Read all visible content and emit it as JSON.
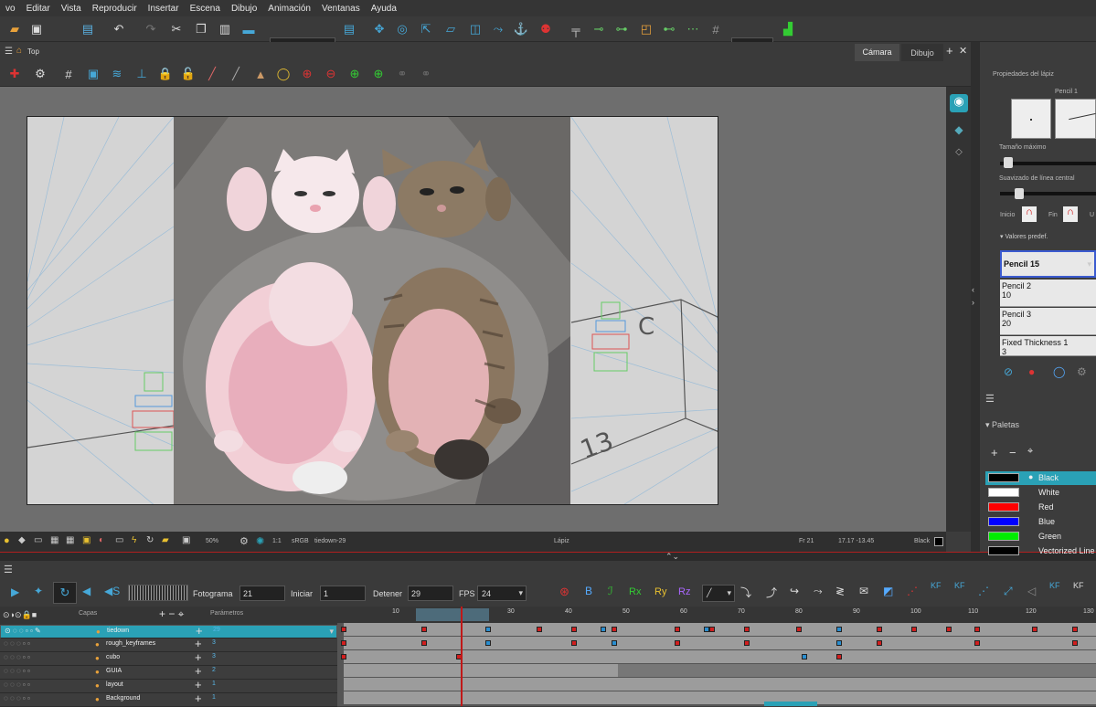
{
  "menu": [
    "vo",
    "Editar",
    "Vista",
    "Reproducir",
    "Insertar",
    "Escena",
    "Dibujo",
    "Animación",
    "Ventanas",
    "Ayuda"
  ],
  "toolbar": {
    "preset": "Default"
  },
  "view": {
    "title": "Top",
    "tabs": [
      "Cámara",
      "Dibujo"
    ],
    "active_tab": "Cámara"
  },
  "status": {
    "zoom": "50%",
    "ratio": "1:1",
    "colorspace": "sRGB",
    "scene": "tiedown-29",
    "tool": "Lápiz",
    "frame": "Fr 21",
    "coords": "17.17 -13.45",
    "color": "Black"
  },
  "timeline": {
    "frame_label": "Fotograma",
    "frame": "21",
    "start_label": "Iniciar",
    "start": "1",
    "stop_label": "Detener",
    "stop": "29",
    "fps_label": "FPS",
    "fps": "24",
    "layers_header": "Capas",
    "params_header": "Parámetros",
    "ruler": [
      "10",
      "20",
      "30",
      "40",
      "50",
      "60",
      "70",
      "80",
      "90",
      "100",
      "110",
      "120",
      "130"
    ],
    "buttons": [
      "Rx",
      "Ry",
      "Rz",
      "KF",
      "KF",
      "KF",
      "KF"
    ]
  },
  "layers": [
    {
      "name": "tiedown",
      "value": "29",
      "selected": true
    },
    {
      "name": "rough_keyframes",
      "value": "3",
      "selected": false
    },
    {
      "name": "cubo",
      "value": "3",
      "selected": false
    },
    {
      "name": "GUIA",
      "value": "2",
      "selected": false
    },
    {
      "name": "layout",
      "value": "1",
      "selected": false
    },
    {
      "name": "Background",
      "value": "1",
      "selected": false
    }
  ],
  "pencil": {
    "title": "Propiedades del lápiz",
    "preset_name": "Pencil 1",
    "max_size": "Tamaño máximo",
    "smoothing": "Suavizado de línea central",
    "start": "Inicio",
    "end": "Fin",
    "u": "U",
    "presets_label": "Valores predef.",
    "presets": [
      {
        "name": "Pencil 1",
        "size": "5"
      },
      {
        "name": "Pencil 2",
        "size": "10"
      },
      {
        "name": "Pencil 3",
        "size": "20"
      },
      {
        "name": "Fixed Thickness 1",
        "size": "3"
      }
    ]
  },
  "palette": {
    "title": "Paletas",
    "colors": [
      {
        "name": "Black",
        "hex": "#000000"
      },
      {
        "name": "White",
        "hex": "#ffffff"
      },
      {
        "name": "Red",
        "hex": "#ff0000"
      },
      {
        "name": "Blue",
        "hex": "#0000ff"
      },
      {
        "name": "Green",
        "hex": "#00ee00"
      },
      {
        "name": "Vectorized Line",
        "hex": "#000000"
      }
    ]
  }
}
